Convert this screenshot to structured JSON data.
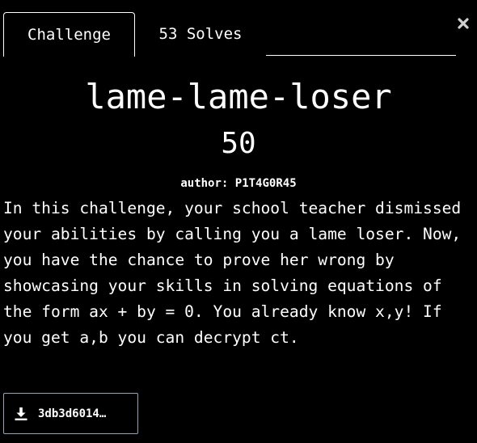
{
  "tabs": {
    "challenge_label": "Challenge",
    "solves_label": "53 Solves"
  },
  "close_icon": "close-icon",
  "challenge": {
    "title": "lame-lame-loser",
    "points": "50",
    "author": "author: P1T4G0R45",
    "description": "In this challenge, your school teacher dismissed your abilities by calling you a lame loser. Now, you have the chance to prove her wrong by showcasing your skills in solving equations of the form ax + by = 0. You already know x,y! If you get a,b you can decrypt ct."
  },
  "file": {
    "icon": "download-icon",
    "name": "3db3d6014…"
  },
  "colors": {
    "background": "#000000",
    "text": "#ffffff",
    "file_border": "#9aa3b0"
  }
}
